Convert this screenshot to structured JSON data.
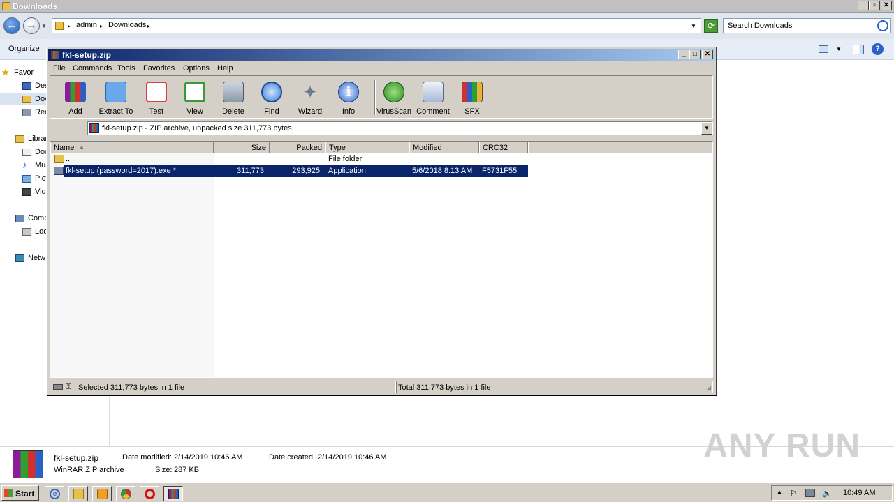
{
  "explorer": {
    "title": "Downloads",
    "address": {
      "seg1": "admin",
      "seg2": "Downloads"
    },
    "search_placeholder": "Search Downloads",
    "organize_label": "Organize",
    "nav": [
      {
        "label": "Favor",
        "icon": "star-icon"
      },
      {
        "label": "Des",
        "icon": "desktop-icon"
      },
      {
        "label": "Dov",
        "icon": "downloads-folder-icon"
      },
      {
        "label": "Rec",
        "icon": "recent-places-icon"
      },
      {
        "label": "Librar",
        "icon": "libraries-icon"
      },
      {
        "label": "Doc",
        "icon": "documents-icon"
      },
      {
        "label": "Mus",
        "icon": "music-icon"
      },
      {
        "label": "Pict",
        "icon": "pictures-icon"
      },
      {
        "label": "Vide",
        "icon": "videos-icon"
      },
      {
        "label": "Comp",
        "icon": "computer-icon"
      },
      {
        "label": "Loc",
        "icon": "local-disk-icon"
      },
      {
        "label": "Netw",
        "icon": "network-icon"
      }
    ],
    "details": {
      "name": "fkl-setup.zip",
      "type": "WinRAR ZIP archive",
      "modified_label": "Date modified:",
      "modified": "2/14/2019 10:46 AM",
      "created_label": "Date created:",
      "created": "2/14/2019 10:46 AM",
      "size_label": "Size:",
      "size": "287 KB"
    }
  },
  "winrar": {
    "title": "fkl-setup.zip",
    "menu": [
      "File",
      "Commands",
      "Tools",
      "Favorites",
      "Options",
      "Help"
    ],
    "tools": [
      {
        "label": "Add",
        "icon": "add-archive-icon",
        "color": "#b03a9c"
      },
      {
        "label": "Extract To",
        "icon": "extract-folder-icon",
        "color": "#4a8fdc"
      },
      {
        "label": "Test",
        "icon": "test-checklist-icon",
        "color": "#d84040"
      },
      {
        "label": "View",
        "icon": "view-book-icon",
        "color": "#3a9a3a"
      },
      {
        "label": "Delete",
        "icon": "trash-icon",
        "color": "#8a9aa8"
      },
      {
        "label": "Find",
        "icon": "magnifier-icon",
        "color": "#3a7ad8"
      },
      {
        "label": "Wizard",
        "icon": "magic-wand-icon",
        "color": "#9aa8c0"
      },
      {
        "label": "Info",
        "icon": "info-icon",
        "color": "#2a62c8"
      },
      {
        "label": "VirusScan",
        "icon": "virus-scan-icon",
        "color": "#3aa83a"
      },
      {
        "label": "Comment",
        "icon": "comment-icon",
        "color": "#8aa0c8"
      },
      {
        "label": "SFX",
        "icon": "sfx-books-icon",
        "color": "#d8a040"
      }
    ],
    "path_text": "fkl-setup.zip - ZIP archive, unpacked size 311,773 bytes",
    "columns": [
      "Name",
      "Size",
      "Packed",
      "Type",
      "Modified",
      "CRC32"
    ],
    "rows": [
      {
        "name": "..",
        "size": "",
        "packed": "",
        "type": "File folder",
        "modified": "",
        "crc": ""
      },
      {
        "name": "fkl-setup (password=2017).exe *",
        "size": "311,773",
        "packed": "293,925",
        "type": "Application",
        "modified": "5/6/2018 8:13 AM",
        "crc": "F5731F55"
      }
    ],
    "status_left": "Selected 311,773 bytes in 1 file",
    "status_right": "Total 311,773 bytes in 1 file"
  },
  "taskbar": {
    "start": "Start",
    "clock": "10:49 AM"
  },
  "watermark": "ANY RUN",
  "colors": {
    "title_active": "#0a246a",
    "selection": "#0a246a",
    "chrome": "#d4d0c8"
  }
}
